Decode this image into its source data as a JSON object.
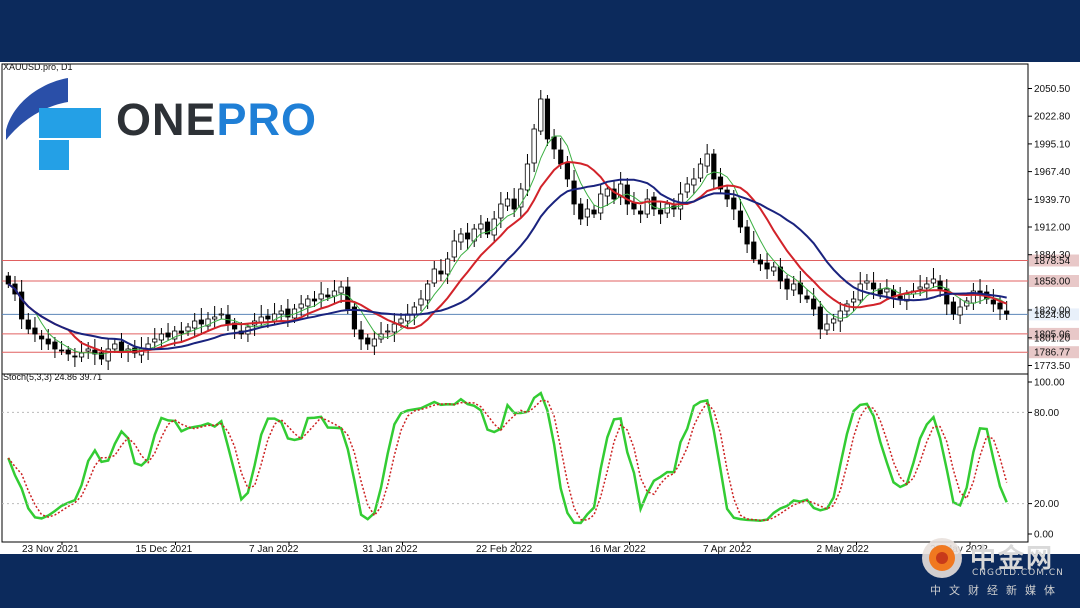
{
  "chart_data": {
    "type": "candlestick",
    "symbol_label": "XAUUSD.pro, D1",
    "indicator_label": "Stoch(5,3,3) 24.86 39.71",
    "price_axis": {
      "range": [
        1765,
        2075
      ],
      "ticks": [
        "2050.50",
        "2022.80",
        "1995.10",
        "1967.40",
        "1939.70",
        "1912.00",
        "1884.30",
        "1829.00",
        "1801.20",
        "1773.50"
      ]
    },
    "stoch_axis": {
      "range": [
        0,
        100
      ],
      "ticks": [
        "100.00",
        "80.00",
        "20.00",
        "0.00"
      ]
    },
    "x_axis": {
      "labels": [
        "23 Nov 2021",
        "15 Dec 2021",
        "7 Jan 2022",
        "31 Jan 2022",
        "22 Feb 2022",
        "16 Mar 2022",
        "7 Apr 2022",
        "2 May 2022",
        "23 May 2022"
      ]
    },
    "levels": [
      {
        "label": "1878.54",
        "value": 1878.5,
        "color": "#e06060"
      },
      {
        "label": "1858.00",
        "value": 1858.0,
        "color": "#e06060"
      },
      {
        "label": "1824.60",
        "value": 1824.6,
        "color": "#5b86b8"
      },
      {
        "label": "1805.06",
        "value": 1805.1,
        "color": "#e06060"
      },
      {
        "label": "1786.77",
        "value": 1786.8,
        "color": "#e06060"
      }
    ],
    "close": [
      1855,
      1845,
      1820,
      1810,
      1805,
      1800,
      1795,
      1790,
      1788,
      1785,
      1782,
      1786,
      1790,
      1785,
      1780,
      1790,
      1795,
      1788,
      1790,
      1786,
      1790,
      1795,
      1800,
      1805,
      1802,
      1808,
      1806,
      1812,
      1818,
      1815,
      1820,
      1822,
      1825,
      1815,
      1810,
      1805,
      1812,
      1818,
      1822,
      1820,
      1825,
      1828,
      1822,
      1830,
      1835,
      1840,
      1838,
      1845,
      1842,
      1848,
      1852,
      1830,
      1810,
      1800,
      1795,
      1800,
      1805,
      1808,
      1815,
      1820,
      1825,
      1832,
      1840,
      1855,
      1870,
      1865,
      1880,
      1898,
      1905,
      1900,
      1910,
      1915,
      1905,
      1920,
      1935,
      1940,
      1930,
      1950,
      1975,
      2010,
      2040,
      2000,
      1990,
      1975,
      1960,
      1935,
      1920,
      1930,
      1925,
      1945,
      1950,
      1940,
      1955,
      1935,
      1930,
      1925,
      1940,
      1930,
      1925,
      1935,
      1930,
      1945,
      1955,
      1960,
      1975,
      1985,
      1960,
      1950,
      1940,
      1930,
      1912,
      1895,
      1880,
      1875,
      1870,
      1872,
      1858,
      1850,
      1855,
      1845,
      1840,
      1830,
      1810,
      1815,
      1820,
      1828,
      1835,
      1840,
      1855,
      1858,
      1850,
      1845,
      1850,
      1842,
      1840,
      1845,
      1848,
      1852,
      1855,
      1860,
      1850,
      1835,
      1825,
      1832,
      1838,
      1848,
      1845,
      1840,
      1835,
      1830,
      1825
    ],
    "sma_fast_color": "#3cb043",
    "sma_mid_color": "#d2232a",
    "sma_slow_color": "#1a237e",
    "stoch_main_color": "#33cc33",
    "stoch_signal_color": "#cc2222",
    "logo": {
      "word_a": "ONE",
      "word_b": "PRO",
      "color_dark": "#2d3136",
      "color_blue": "#1f7fd6"
    },
    "watermark": {
      "title": "中金网",
      "url": "CNGOLD.COM.CN",
      "subtitle": "中文财经新媒体"
    }
  }
}
